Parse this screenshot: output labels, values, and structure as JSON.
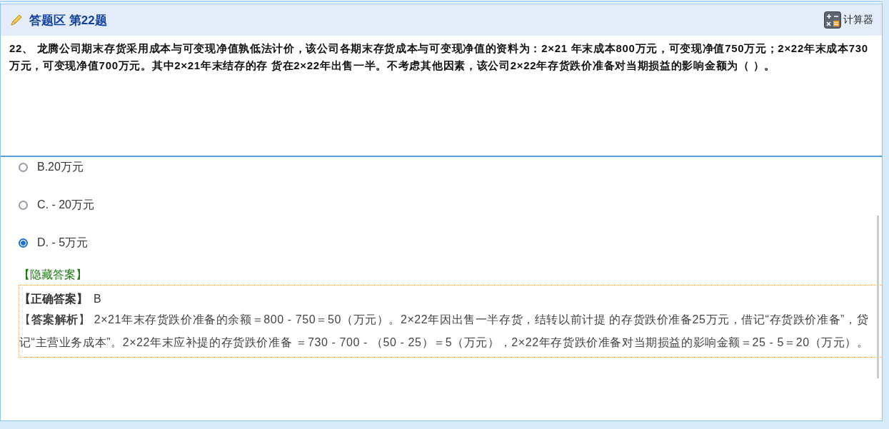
{
  "header": {
    "title": "答题区 第22题",
    "calculator_label": "计算器"
  },
  "question": {
    "number": "22、",
    "text": "龙腾公司期末存货采用成本与可变现净值孰低法计价，该公司各期末存货成本与可变现净值的资料为：2×21 年末成本800万元，可变现净值750万元；2×22年末成本730万元，可变现净值700万元。其中2×21年末结存的存 货在2×22年出售一半。不考虑其他因素，该公司2×22年存货跌价准备对当期损益的影响金额为（ ）。"
  },
  "options": [
    {
      "label": "B.20万元",
      "selected": false
    },
    {
      "label": "C. - 20万元",
      "selected": false
    },
    {
      "label": "D. - 5万元",
      "selected": true
    }
  ],
  "hide_answer_link": "【隐藏答案】",
  "answer": {
    "label": "【**正确答案**】",
    "value": "B"
  },
  "analysis": {
    "text": "【**答案解析**】 2×21年末存货跌价准备的余额＝800 - 750＝50（万元）。2×22年因出售一半存货，结转以前计提 的存货跌价准备25万元，借记“存货跌价准备”，贷记“主营业务成本”。2×22年末应补提的存货跌价准备 ＝730 - 700 - （50 - 25）＝5（万元），2×22年存货跌价准备对当期损益的影响金额＝25 - 5＝20（万元）。"
  }
}
